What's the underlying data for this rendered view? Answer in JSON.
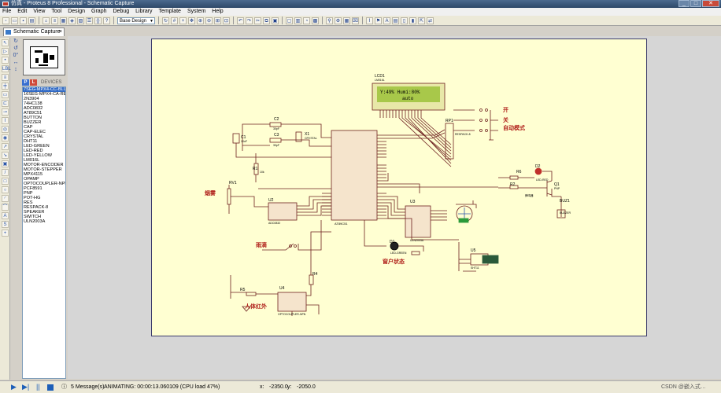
{
  "window": {
    "title": "仿真 - Proteus 8 Professional - Schematic Capture"
  },
  "menu": [
    "File",
    "Edit",
    "View",
    "Tool",
    "Design",
    "Graph",
    "Debug",
    "Library",
    "Template",
    "System",
    "Help"
  ],
  "toolbar": {
    "design_select": "Base Design"
  },
  "tab": {
    "label": "Schematic Capture",
    "close": "×"
  },
  "rotation": {
    "angle": "0°"
  },
  "devices": {
    "p_label": "P",
    "l_label": "L",
    "title": "DEVICES",
    "items": [
      "7SEG-MPX4-CC-BLUE",
      "16SEG-MPX4-CA-RED",
      "2N3904",
      "74HC138",
      "ADC0832",
      "AT89C51",
      "BUTTON",
      "BUZZER",
      "CAP",
      "CAP-ELEC",
      "CRYSTAL",
      "DHT11",
      "LED-GREEN",
      "LED-RED",
      "LED-YELLOW",
      "LM016L",
      "MOTOR-ENCODER",
      "MOTOR-STEPPER",
      "MPX4115",
      "OPAMP",
      "OPTOCOUPLER-NPN",
      "PCF8591",
      "PNP",
      "POT-HG",
      "RES",
      "RESPACK-8",
      "SPEAKER",
      "SWITCH",
      "ULN2003A"
    ],
    "selected_index": 0
  },
  "schematic": {
    "lcd": {
      "ref": "LCD1",
      "part": "LM016L",
      "line1": "Y:49% Humi:80%",
      "line2": "auto"
    },
    "mcu": {
      "ref": "U1",
      "part": "AT89C51"
    },
    "labels": {
      "open": "开",
      "close": "关",
      "auto_mode": "自动模式",
      "smoke": "烟雾",
      "rain": "雨滴",
      "window_state": "窗户状态",
      "pir": "人体红外",
      "buzzer": "蜂鸣器"
    },
    "refs": {
      "c1": "C1",
      "c2": "C2",
      "c3": "C3",
      "x1": "X1",
      "r1": "R1",
      "rv1": "RV1",
      "u2": "U2",
      "u3": "U3",
      "u4": "U4",
      "u5": "U5",
      "rp1": "RP1",
      "r2": "R2",
      "r4": "R4",
      "r5": "R5",
      "r6": "R6",
      "d1": "D1",
      "d2": "D2",
      "q1": "Q1",
      "buz1": "BUZ1"
    },
    "parts": {
      "c2_val": "30pF",
      "c3_val": "30pF",
      "c1_val": "10uF",
      "x1_val": "CRYSTAL",
      "r1_val": "10k",
      "u2_part": "ADC0832",
      "u3_part": "ULN2003A",
      "u4_part": "OPTOCOUPLER-NPN",
      "u5_part": "SHT11",
      "rp1_part": "RESPACK-8",
      "d1_part": "LED-GREEN",
      "d2_part": "LED-RED",
      "q1_part": "PNP",
      "buz_part": "BUZZER"
    }
  },
  "status": {
    "messages": "5 Message(s)",
    "animating": "ANIMATING: 00:00:13.060109 (CPU load 47%)",
    "x_label": "x:",
    "x_value": "-2350.0",
    "y_label": "y:",
    "y_value": "-2050.0",
    "watermark": "CSDN @嵌入式…"
  },
  "colors": {
    "sheet": "#ffffd2",
    "wire": "#6e2020",
    "lcd_bg": "#a8c84a",
    "selection": "#316ac5"
  }
}
